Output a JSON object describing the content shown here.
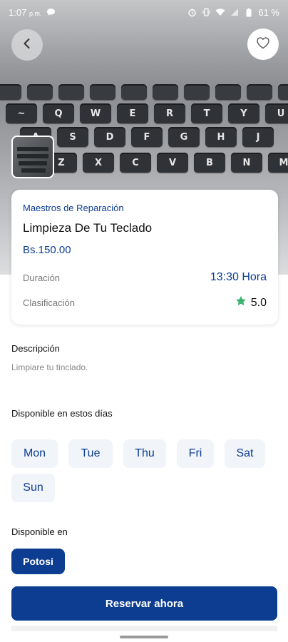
{
  "status_bar": {
    "time": "1:07",
    "ampm": "p.m.",
    "battery": "61 %",
    "icons": [
      "chat-bubble-icon",
      "alarm-icon",
      "vibrate-icon",
      "wifi-icon",
      "signal-icon",
      "battery-icon"
    ]
  },
  "header": {
    "back_icon": "chevron-left-icon",
    "favorite_icon": "heart-outline-icon"
  },
  "service": {
    "category": "Maestros de Reparación",
    "title": "Limpieza De Tu Teclado",
    "price": "Bs.150.00",
    "duration_label": "Duración",
    "duration_value": "13:30 Hora",
    "rating_label": "Clasificación",
    "rating_value": "5.0"
  },
  "description": {
    "title": "Descripción",
    "text": "Limpiare tu tinclado."
  },
  "availability": {
    "title": "Disponible en estos días",
    "days": [
      "Mon",
      "Tue",
      "Thu",
      "Fri",
      "Sat",
      "Sun"
    ]
  },
  "location": {
    "title": "Disponible en",
    "city": "Potosi"
  },
  "actions": {
    "book_label": "Reservar ahora"
  },
  "colors": {
    "primary": "#0c3d91",
    "chip_bg": "#f1f4f8",
    "star": "#3cb371"
  }
}
